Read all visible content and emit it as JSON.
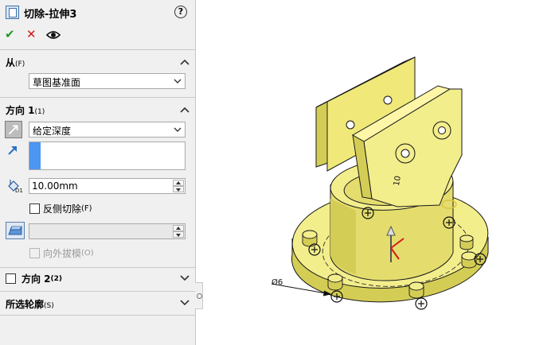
{
  "header": {
    "title": "切除-拉伸3",
    "help_glyph": "?"
  },
  "actions": {
    "ok_glyph": "✔",
    "cancel_glyph": "✕"
  },
  "from_section": {
    "title": "从",
    "title_suffix": "(F)",
    "selected": "草图基准面"
  },
  "direction1": {
    "title": "方向 1",
    "title_suffix": "(1)",
    "end_condition": "给定深度",
    "depth_value": "10.00mm",
    "flip_side_label": "反侧切除",
    "flip_side_suffix": "(F)",
    "flip_side_checked": false,
    "draft_outward_label": "向外拔模",
    "draft_outward_suffix": "(O)"
  },
  "direction2": {
    "title": "方向 2",
    "title_suffix": "(2)",
    "checked": false
  },
  "selected_contours": {
    "title": "所选轮廓",
    "title_suffix": "(S)"
  },
  "viewport": {
    "dim_label_1": "Ø6",
    "dim_label_2": "10"
  },
  "colors": {
    "part_yellow": "#f3ee8c",
    "part_shade": "#d4cd55",
    "accent_blue": "#4b96f3",
    "panel_bg": "#f0f0f0"
  },
  "icons": [
    "feature-icon",
    "help-icon",
    "ok-icon",
    "cancel-icon",
    "eye-icon",
    "chevron-up-icon",
    "chevron-down-icon",
    "reverse-direction-icon",
    "direction-arrow-icon",
    "depth-icon",
    "draft-icon"
  ]
}
